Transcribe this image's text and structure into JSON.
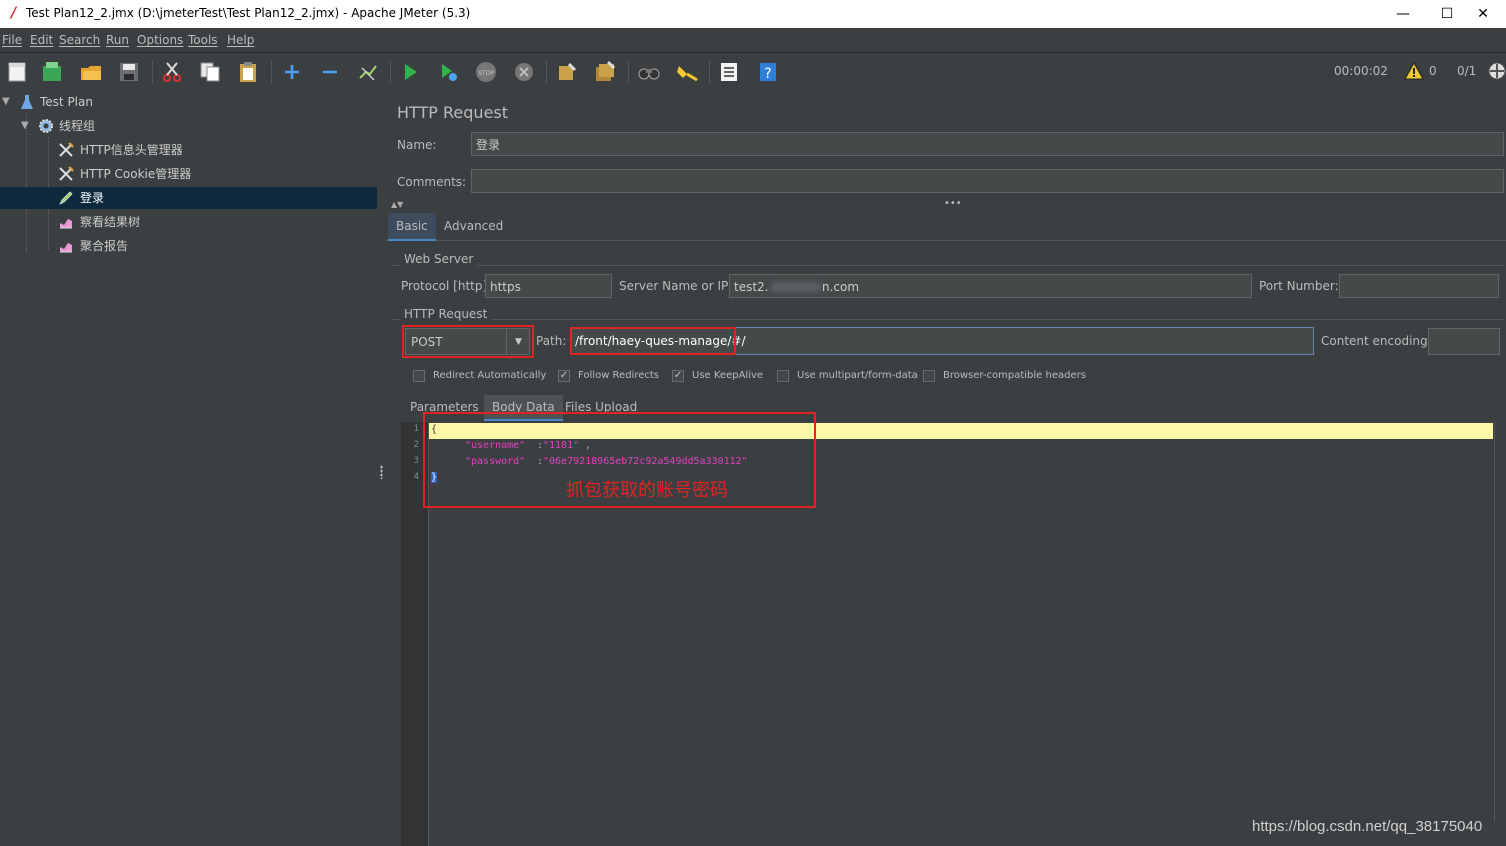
{
  "window": {
    "title": "Test Plan12_2.jmx (D:\\jmeterTest\\Test Plan12_2.jmx) - Apache JMeter (5.3)",
    "minimize": "—",
    "maximize": "☐",
    "close": "✕"
  },
  "menu": [
    "File",
    "Edit",
    "Search",
    "Run",
    "Options",
    "Tools",
    "Help"
  ],
  "status": {
    "timer": "00:00:02",
    "warnings": "0",
    "threads": "0/1"
  },
  "tree": {
    "root": "Test Plan",
    "thread_group": "线程组",
    "children": [
      "HTTP信息头管理器",
      "HTTP Cookie管理器",
      "登录",
      "察看结果树",
      "聚合报告"
    ]
  },
  "panel": {
    "title": "HTTP Request",
    "name_label": "Name:",
    "name_value": "登录",
    "comments_label": "Comments:",
    "comments_value": "",
    "tabs": [
      "Basic",
      "Advanced"
    ],
    "web_server_title": "Web Server",
    "protocol_label": "Protocol [http]:",
    "protocol_value": "https",
    "server_label": "Server Name or IP:",
    "server_value_start": "test2.",
    "server_value_end": "n.com",
    "port_label": "Port Number:",
    "port_value": "",
    "http_request_title": "HTTP Request",
    "method": "POST",
    "path_label": "Path:",
    "path_value": "/front/haey-ques-manage/#/",
    "encoding_label": "Content encoding:",
    "encoding_value": "",
    "checkboxes": [
      {
        "label": "Redirect Automatically",
        "checked": false
      },
      {
        "label": "Follow Redirects",
        "checked": true
      },
      {
        "label": "Use KeepAlive",
        "checked": true
      },
      {
        "label": "Use multipart/form-data",
        "checked": false
      },
      {
        "label": "Browser-compatible headers",
        "checked": false
      }
    ],
    "subtabs": [
      "Parameters",
      "Body Data",
      "Files Upload"
    ]
  },
  "editor": {
    "line_numbers": [
      "1",
      "2",
      "3",
      "4"
    ],
    "line1": "{",
    "line2_key": "\"username\"",
    "line2_colon": ":",
    "line2_val": "\"1181\"",
    "line2_comma": ",",
    "line3_key": "\"password\"",
    "line3_colon": ":",
    "line3_val": "\"06e79218965eb72c92a549dd5a330112\"",
    "line4": "}",
    "annotation": "抓包获取的账号密码"
  },
  "watermark": "https://blog.csdn.net/qq_38175040",
  "colors": {
    "background": "#3c3f41",
    "selection": "#0d293e",
    "annotation_red": "#e02424",
    "code_string": "#e040c0",
    "current_line": "#fff7a8"
  }
}
